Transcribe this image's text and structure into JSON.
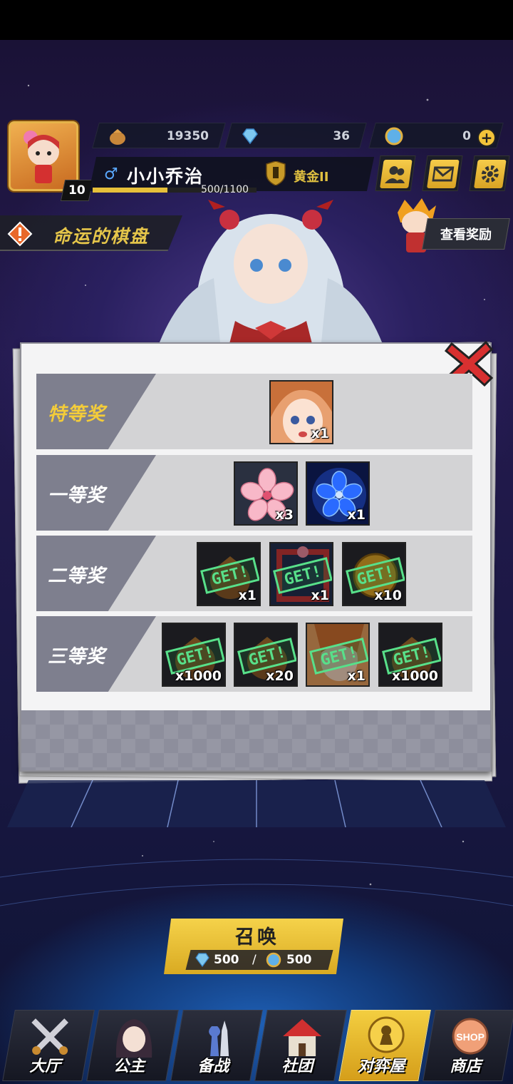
{
  "currencies": [
    {
      "icon": "gold-pouch-icon",
      "value": "19350"
    },
    {
      "icon": "diamond-icon",
      "value": "36"
    },
    {
      "icon": "coin-token-icon",
      "value": "0"
    }
  ],
  "player": {
    "level": "10",
    "name": "小小乔治",
    "rank": "黄金II",
    "xp_text": "500/1100",
    "xp_fraction": 0.4545
  },
  "event": {
    "title": "命运的棋盘",
    "view_reward_label": "查看奖励"
  },
  "prizes": [
    {
      "label": "特等奖",
      "highlight": true,
      "items": [
        {
          "kind": "portrait-girl",
          "qty": "x1",
          "obtained": false
        }
      ]
    },
    {
      "label": "一等奖",
      "highlight": false,
      "items": [
        {
          "kind": "sakura-flower",
          "qty": "x3",
          "obtained": false
        },
        {
          "kind": "blue-flower",
          "qty": "x1",
          "obtained": false
        }
      ]
    },
    {
      "label": "二等奖",
      "highlight": false,
      "items": [
        {
          "kind": "pouch",
          "qty": "x1",
          "obtained": true
        },
        {
          "kind": "frame",
          "qty": "x1",
          "obtained": true
        },
        {
          "kind": "coin",
          "qty": "x10",
          "obtained": true
        }
      ]
    },
    {
      "label": "三等奖",
      "highlight": false,
      "items": [
        {
          "kind": "pouch",
          "qty": "x1000",
          "obtained": true
        },
        {
          "kind": "pouch",
          "qty": "x20",
          "obtained": true
        },
        {
          "kind": "portrait-orange",
          "qty": "x1",
          "obtained": true
        },
        {
          "kind": "pouch",
          "qty": "x1000",
          "obtained": true
        }
      ]
    }
  ],
  "stamp_text": "GET!",
  "summon": {
    "title": "召唤",
    "cost1": "500",
    "separator": "/",
    "cost2": "500"
  },
  "nav": [
    {
      "label": "大厅",
      "icon": "crossed-swords-icon",
      "active": false
    },
    {
      "label": "公主",
      "icon": "princess-icon",
      "active": false
    },
    {
      "label": "备战",
      "icon": "chess-pieces-icon",
      "active": false
    },
    {
      "label": "社团",
      "icon": "guild-house-icon",
      "active": false
    },
    {
      "label": "对弈屋",
      "icon": "golden-pawn-icon",
      "active": true
    },
    {
      "label": "商店",
      "icon": "shop-icon",
      "active": false
    }
  ],
  "colors": {
    "accent_gold": "#f3cc3a",
    "stamp_green": "#58e08a",
    "row_label_bg": "#7e7f8e"
  }
}
